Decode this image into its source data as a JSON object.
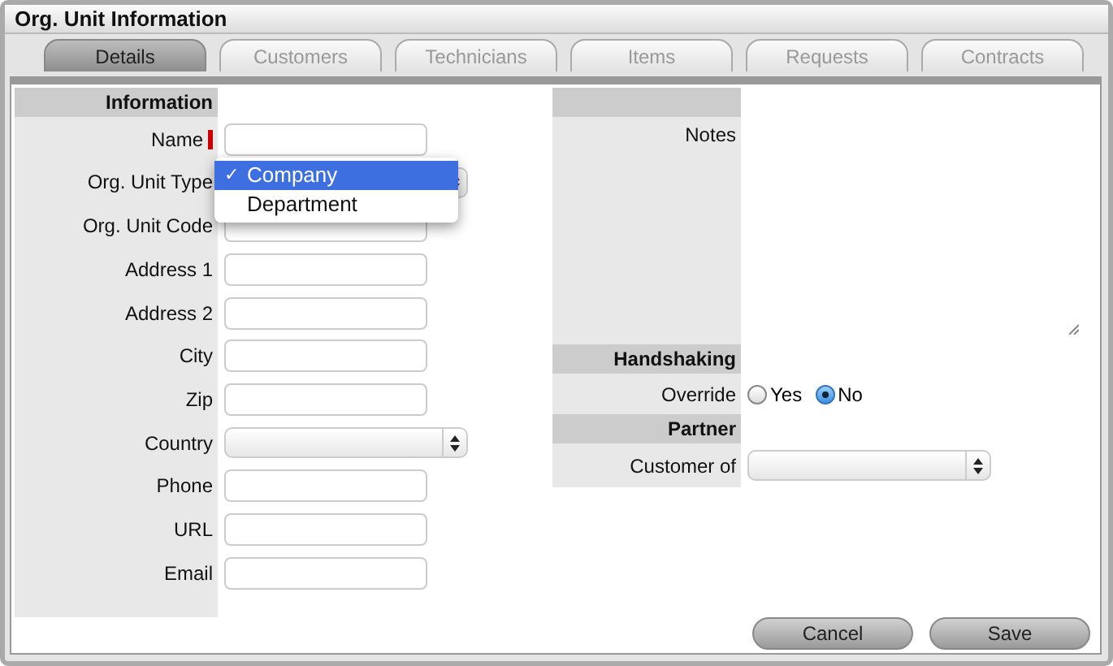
{
  "window": {
    "title": "Org. Unit Information"
  },
  "tabs": [
    {
      "label": "Details",
      "selected": true
    },
    {
      "label": "Customers",
      "selected": false
    },
    {
      "label": "Technicians",
      "selected": false
    },
    {
      "label": "Items",
      "selected": false
    },
    {
      "label": "Requests",
      "selected": false
    },
    {
      "label": "Contracts",
      "selected": false
    }
  ],
  "information": {
    "heading": "Information",
    "fields": [
      {
        "label": "Name",
        "kind": "text",
        "required": true
      },
      {
        "label": "Org. Unit Type",
        "kind": "select",
        "required": false
      },
      {
        "label": "Org. Unit Code",
        "kind": "text",
        "required": false
      },
      {
        "label": "Address 1",
        "kind": "text",
        "required": false
      },
      {
        "label": "Address 2",
        "kind": "text",
        "required": false
      },
      {
        "label": "City",
        "kind": "text",
        "required": false
      },
      {
        "label": "Zip",
        "kind": "text",
        "required": false
      },
      {
        "label": "Country",
        "kind": "select",
        "required": false
      },
      {
        "label": "Phone",
        "kind": "text",
        "required": false
      },
      {
        "label": "URL",
        "kind": "text",
        "required": false
      },
      {
        "label": "Email",
        "kind": "text",
        "required": false
      }
    ]
  },
  "type_menu": {
    "check": "✓",
    "options": [
      {
        "label": "Company",
        "selected": true
      },
      {
        "label": "Department",
        "selected": false
      }
    ]
  },
  "notes": {
    "label": "Notes"
  },
  "handshaking": {
    "heading": "Handshaking",
    "label": "Override",
    "options": [
      {
        "label": "Yes",
        "selected": false
      },
      {
        "label": "No",
        "selected": true
      }
    ]
  },
  "partner": {
    "heading": "Partner",
    "label": "Customer of"
  },
  "buttons": [
    "Cancel",
    "Save"
  ]
}
